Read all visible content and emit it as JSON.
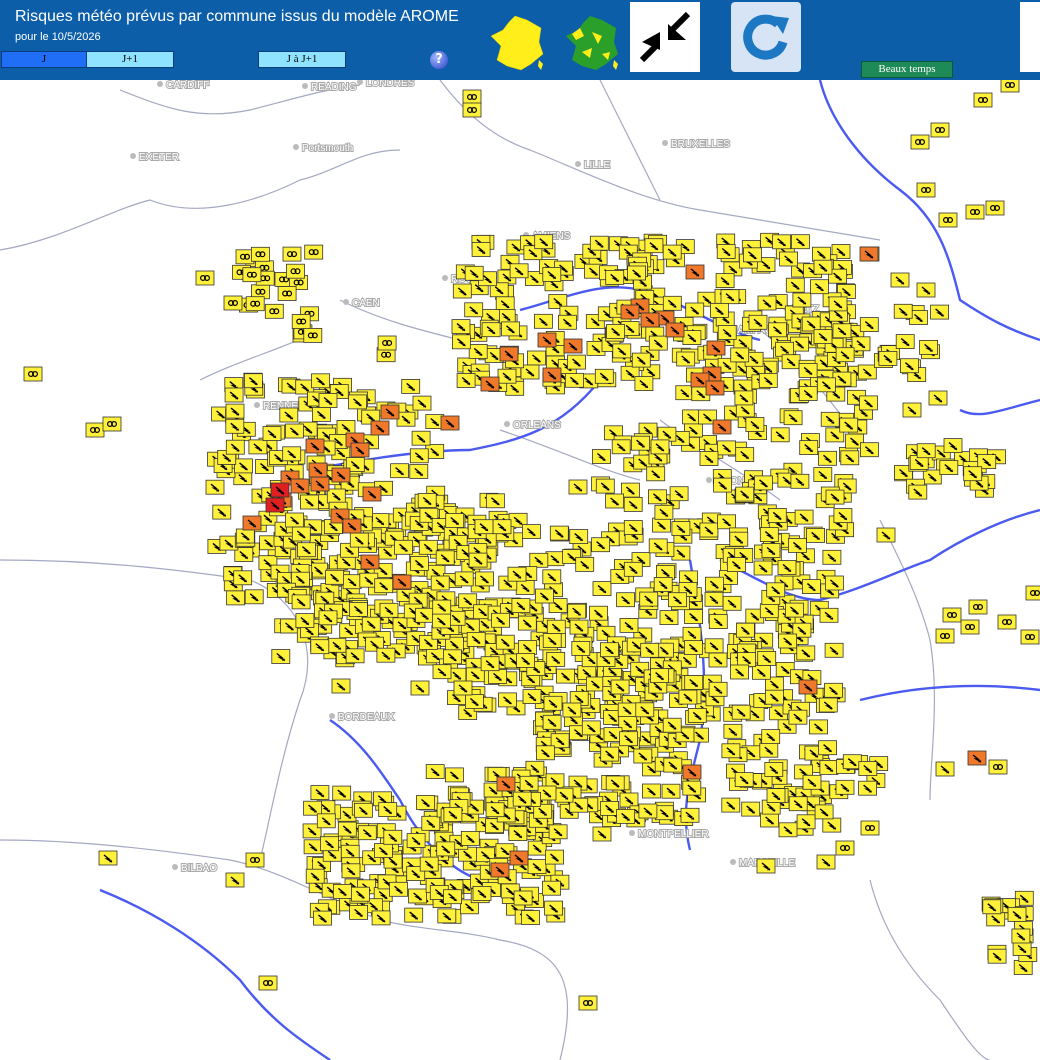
{
  "header": {
    "title": "Risques météo prévus par commune issus du modèle AROME",
    "subtitle": "pour le 10/5/2026",
    "tabs": [
      "J",
      "J+1",
      "J à J+1"
    ],
    "help_label": "?",
    "legend_button": "Beaux temps",
    "controls": [
      "france-yellow-icon",
      "france-green-icon",
      "collapse-icon",
      "refresh-icon"
    ]
  },
  "cities": [
    "CARDIFF",
    "READING",
    "LONDRES",
    "EXETER",
    "Portsmouth",
    "LILLE",
    "BRUXELLES",
    "AMIENS",
    "ROUEN",
    "CAEN",
    "RENNES",
    "ORLEANS",
    "CHAMPAGNE",
    "DIJON",
    "BORDEAUX",
    "MONTPELLIER",
    "MARSEILLE",
    "BILBAO",
    "METZ"
  ],
  "colors": {
    "header": "#0c5ea8",
    "yellow": "#fff03a",
    "orange": "#f0782a",
    "red": "#e02020",
    "river": "#4a5ae8",
    "border": "#a0a6c0"
  },
  "alert_levels": [
    "yellow",
    "orange",
    "red"
  ]
}
